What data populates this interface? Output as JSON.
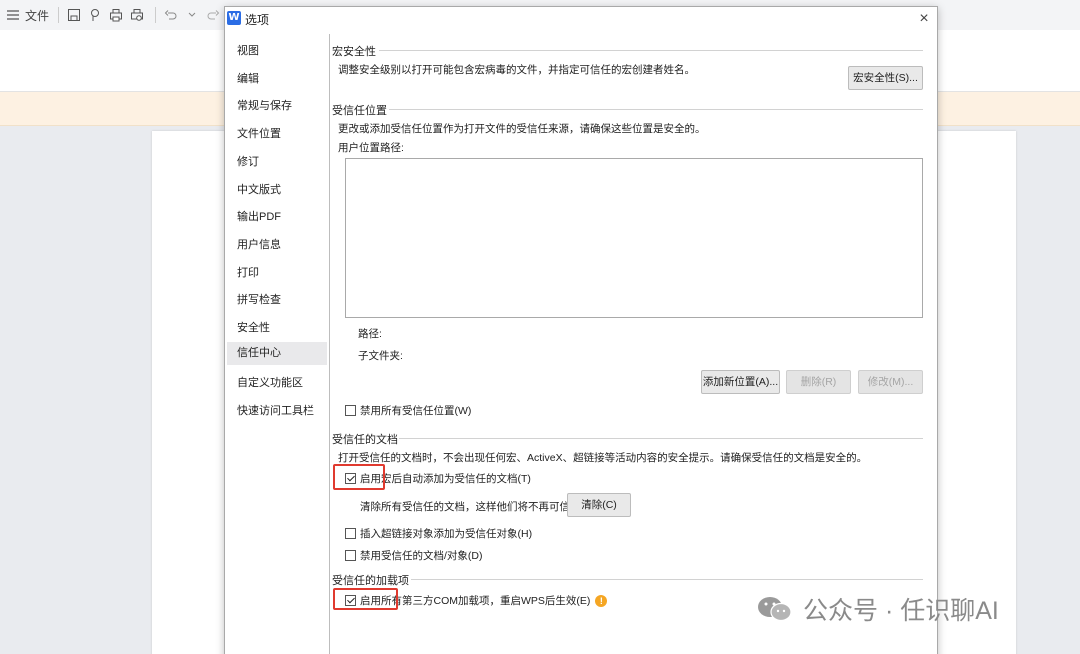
{
  "app": {
    "file_menu_label": "文件",
    "toolbar_icons": [
      "menu-icon",
      "save-icon",
      "export-icon",
      "print-icon",
      "print-preview-icon",
      "undo-icon",
      "redo-icon"
    ]
  },
  "dialog": {
    "logo_letter": "W",
    "title": "选项",
    "close_glyph": "×"
  },
  "nav": {
    "items": [
      {
        "label": "视图"
      },
      {
        "label": "编辑"
      },
      {
        "label": "常规与保存"
      },
      {
        "label": "文件位置"
      },
      {
        "label": "修订"
      },
      {
        "label": "中文版式"
      },
      {
        "label": "输出PDF"
      },
      {
        "label": "用户信息"
      },
      {
        "label": "打印"
      },
      {
        "label": "拼写检查"
      },
      {
        "label": "安全性"
      },
      {
        "label": "信任中心"
      },
      {
        "label": "自定义功能区"
      },
      {
        "label": "快速访问工具栏"
      }
    ],
    "active": "信任中心"
  },
  "macro_security": {
    "title": "宏安全性",
    "desc": "调整安全级别以打开可能包含宏病毒的文件，并指定可信任的宏创建者姓名。",
    "button": "宏安全性(S)..."
  },
  "trusted_locations": {
    "title": "受信任位置",
    "desc": "更改或添加受信任位置作为打开文件的受信任来源，请确保这些位置是安全的。",
    "user_path_label": "用户位置路径:",
    "path_label": "路径:",
    "subfolder_label": "子文件夹:",
    "add_button": "添加新位置(A)...",
    "delete_button": "删除(R)",
    "modify_button": "修改(M)...",
    "disable_all": {
      "label": "禁用所有受信任位置(W)",
      "checked": false
    }
  },
  "trusted_documents": {
    "title": "受信任的文档",
    "desc": "打开受信任的文档时，不会出现任何宏、ActiveX、超链接等活动内容的安全提示。请确保受信任的文档是安全的。",
    "enable_macros": {
      "label": "启用宏后自动添加为受信任的文档(T)",
      "checked": true
    },
    "clear_label": "清除所有受信任的文档，这样他们将不再可信",
    "clear_button": "清除(C)",
    "insert_hyperlink": {
      "label": "插入超链接对象添加为受信任对象(H)",
      "checked": false
    },
    "disable_trusted": {
      "label": "禁用受信任的文档/对象(D)",
      "checked": false
    }
  },
  "trusted_addins": {
    "title": "受信任的加载项",
    "enable_com": {
      "label": "启用所有第三方COM加载项，重启WPS后生效(E)",
      "checked": true
    },
    "info_glyph": "!"
  },
  "watermark": {
    "text": "公众号 · 任识聊AI"
  },
  "colors": {
    "highlight_box": "#e03a2f",
    "info_icon": "#f5a623",
    "wps_logo": "#2b6de5"
  }
}
